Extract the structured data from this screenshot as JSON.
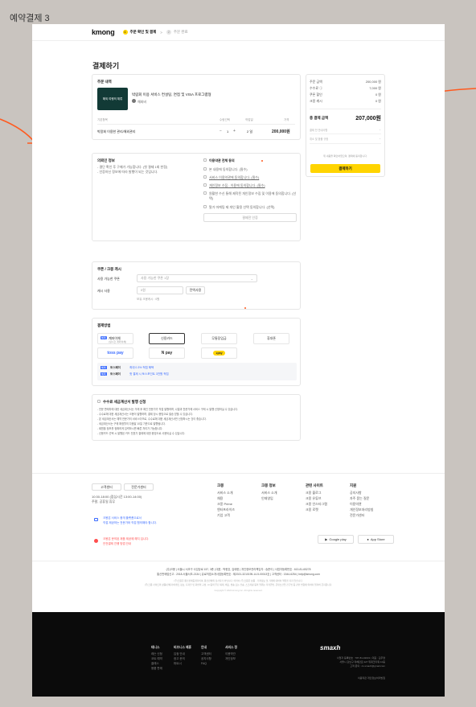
{
  "page_tag": "예약결제 3",
  "header": {
    "logo": "kmong",
    "step1_num": "1",
    "step1": "주문 확인 및 결제",
    "sep": ">",
    "step2_num": "2",
    "step2": "주문 완료"
  },
  "title": "결제하기",
  "order": {
    "heading": "주문 내역",
    "thumb_text": "해외 여행의 체류",
    "product": "박람회 이용 서비스 컨설팅, 면접 및 VISA 프로그램형",
    "seller": "해외비",
    "cols": [
      "기본항목",
      "수량선택",
      "작업일",
      "가격"
    ],
    "item": "박람회 이용한 관리/해외관리",
    "minus": "−",
    "qty": "1",
    "plus": "+",
    "days": "2 일",
    "price": "200,000원"
  },
  "buyer": {
    "heading": "의뢰인 정보",
    "line1": "- 결단 확인 후 구매가 가능합니다. (첫 결제 1회 한정)",
    "line2": "- 인증하신 정보에 따라 발행이 되는 것입니다."
  },
  "agree": {
    "all": "이용약관 전체 동의",
    "items": [
      "본 내용에 동의합니다. (필수)",
      "서비스 이용약관에 동의합니다. (필수)",
      "개인정보 수집 · 이용에 동의합니다. (필수)",
      "원활한 수신 통해 제작된 개인정보 수집 및 이용에 동의합니다. (선택)",
      "탈거 마케팅 제 개인 활용 선택 동의합니다. (선택)"
    ],
    "button": "결제전 인증"
  },
  "coupon": {
    "heading": "쿠폰 / 크몽 캐시",
    "coupon_label": "사용 가능한 쿠폰",
    "coupon_value": "사용 가능한 쿠폰 1장",
    "cash_label": "캐시 사용",
    "cash_value": "0원",
    "cash_button": "전액사용",
    "cash_hint": "보유 크몽캐시 : 0원"
  },
  "payment": {
    "heading": "결제방법",
    "badge": "혜택",
    "bank": "계좌이체",
    "bank_sub": "(실시간 계좌이체)",
    "methods": [
      "신용카드",
      "무통장입금",
      "휴대폰"
    ],
    "toss": "toss pay",
    "npay": "N pay",
    "kakao": "●pay",
    "benefit1_label": "혜택",
    "benefit1": "토스페이",
    "benefit1_link": "최대 0.3% 적립 혜택",
    "benefit2_label": "혜택",
    "benefit2": "토스페이",
    "benefit2_link": "첫 결제 시 토스포인트 3천원 적립"
  },
  "tax": {
    "heading": "수수료 세금계산서 발행 신청",
    "lines": [
      "- 전문 판매자에 대한 세금계산서는 거래 후 확인 전문가가 직접 발행하며, 나열과 전문가에 서비스 구매 시 발행 신청하실 수 있습니다.",
      "- 수수료에 대한 세금계산서는 크몽이 발행하며, 결제 당시 증빙으로 발송 받을 수 있습니다.",
      "- 본 세금계산서는 예약 전문가의 서비스이므로, 수수료에 대한 세금계산서만 신청하시는 것이 좋습니다.",
      "- 세금계산서는 구매 확정월의 다음달 10일 기준으로 발행됩니다.",
      "- 회원을 정보를 정확하게 입력하시면 빠른 처리가 가능합니다.",
      "- 신용카드 선택 시 발행된 카드 전표가 결제에 대한 증빙으로 사용되실 수 있습니다."
    ]
  },
  "summary": {
    "rows": [
      {
        "label": "주문 금액",
        "value": "200,000 원"
      },
      {
        "label": "수수료 ⓘ",
        "value": "7,000 원"
      },
      {
        "label": "쿠폰 할인",
        "value": "0 원"
      },
      {
        "label": "크몽 캐시",
        "value": "0 원"
      }
    ],
    "total_label": "총 결제 금액",
    "total_value": "207,000원",
    "sub1": "결제 전 안내사항",
    "sub2": "취소 및 환불 규정",
    "notice": "위 내용을 확인하였으며, 결제에 동의합니다.",
    "pay_button": "결제하기"
  },
  "footer": {
    "btn1": "고객센터",
    "btn2": "전문가센터",
    "hours": "10:30-18:00 (점심시간 13:00-14:00)",
    "hours2": "주말, 공휴일 휴무",
    "notice1a": "크몽은 서비스 중개 플랫폼으로서",
    "notice1b": "직접 제공하는 전문가와 직접 협의해야 합니다.",
    "notice2a": "크몽은 문의된 제품 제공에 해지 입니다.",
    "notice2b": "안전결제 진행 방법 안내",
    "cols": [
      {
        "h": "크몽",
        "items": [
          "서비스 소개",
          "채용",
          "크몽 Prime",
          "엔터프라이즈",
          "기업 고객"
        ]
      },
      {
        "h": "크몽 정보",
        "items": [
          "서비스 소개",
          "인재영입"
        ]
      },
      {
        "h": "관련 사이트",
        "items": [
          "크몽 블로그",
          "크몽 유튜브",
          "크몽 인스타그램",
          "크몽 로켓"
        ]
      },
      {
        "h": "지원",
        "items": [
          "공지사항",
          "자주 묻는 질문",
          "이용약관",
          "개인정보처리방침",
          "전문가센터"
        ]
      }
    ],
    "google": "Google play",
    "apple": "App Store",
    "company": "(주)크몽 | 서울시 서초구 사임당로 157, 3층 | 대표 : 박현호, 김태헌 | 개인정보관리책임자 : 송준이 | 사업자등록번호 : 613-81-65278",
    "company2": "통신판매업신고 : 2018-서울서초-2134 | 유료직업소개사업등록번호 : 제2021-3210195-14-5-00013호 | 고객센터 : 1544-6254 | help@kmong.com",
    "legal1": "(주)크몽은 통신판매중개자이며, 통신판매의 당사자가 아닙니다. 따라서 (주)크몽은 상품 · 거래정보 및 거래에 대하여 책임을 지지 않습니다.",
    "legal2": "(주)크몽 사이트의 상품/판매자/이벤트 정보, 디자인 및 화면의 구성, UI 등의 무단 복제, 배포, 방송 또는 전송, 스크래핑 등의 행위는 저작권법, 콘텐츠산업 진흥법 등 관련 법령에 의하여 엄격히 금지됩니다.",
    "copyright": "Copyright © 2024 kmong Inc. All rights reserved."
  },
  "dark_footer": {
    "cols": [
      {
        "h": "테니스",
        "items": [
          "레슨 신청",
          "코트 예약",
          "클래스",
          "용품 판매"
        ]
      },
      {
        "h": "비즈니스 제휴",
        "items": [
          "입점 안내",
          "광고 문의",
          "파트너"
        ]
      },
      {
        "h": "안내",
        "items": [
          "고객센터",
          "공지사항",
          "FAQ"
        ]
      },
      {
        "h": "서비스 정",
        "items": [
          "이용약관",
          "개인정보"
        ]
      }
    ],
    "brand": "smaxh",
    "info1": "사업자 등록번호 : 787-81-02031 | 대표 : 김주영",
    "info2": "서울시 강남구 테헤란로 427 위워크타워 10층",
    "info3": "고객 문의 : cs.smaxh@gmail.com",
    "links": "이용약관   개인정보처리방침"
  },
  "colors": {
    "accent": "#ffd400",
    "annotation": "#ff5a1f",
    "dark": "#0b0b0b"
  }
}
